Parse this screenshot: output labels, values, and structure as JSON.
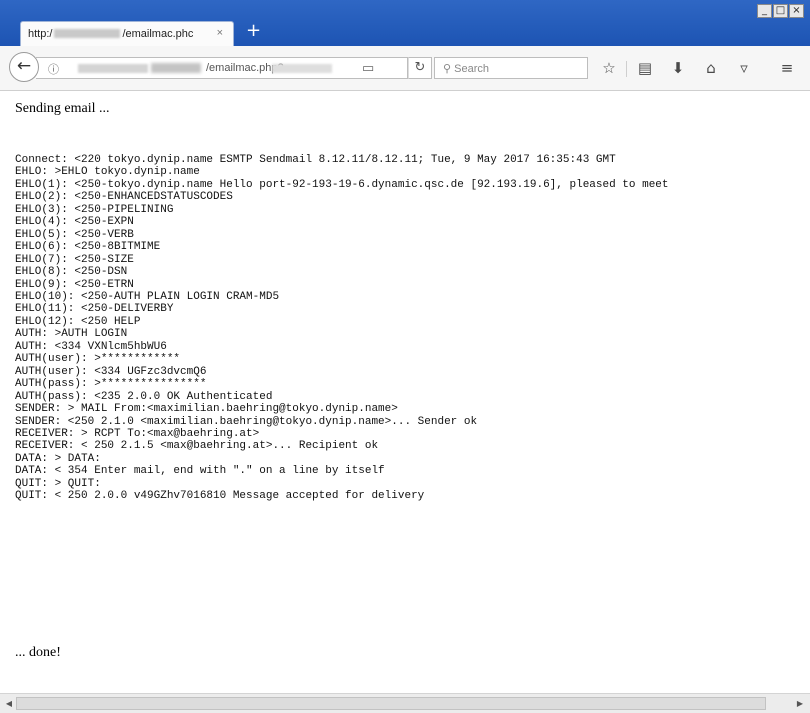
{
  "browser": {
    "tab_title_prefix": "http:/",
    "tab_title_suffix": "/emailmac.phc",
    "tab_close": "×",
    "new_tab": "+",
    "window_buttons": [
      "_",
      "□",
      "×"
    ],
    "url_text": "/emailmac.php?",
    "search_placeholder": "Search",
    "icons": [
      "back-arrow-icon",
      "info-icon",
      "reader-view-icon",
      "reload-icon",
      "search-icon",
      "bookmark-star-icon",
      "bookmarks-library-icon",
      "downloads-icon",
      "home-icon",
      "pocket-icon",
      "menu-icon"
    ]
  },
  "page": {
    "heading": "Sending email ...",
    "log_lines": [
      "Connect: <220 tokyo.dynip.name ESMTP Sendmail 8.12.11/8.12.11; Tue, 9 May 2017 16:35:43 GMT",
      "EHLO: >EHLO tokyo.dynip.name",
      "EHLO(1): <250-tokyo.dynip.name Hello port-92-193-19-6.dynamic.qsc.de [92.193.19.6], pleased to meet",
      "EHLO(2): <250-ENHANCEDSTATUSCODES",
      "EHLO(3): <250-PIPELINING",
      "EHLO(4): <250-EXPN",
      "EHLO(5): <250-VERB",
      "EHLO(6): <250-8BITMIME",
      "EHLO(7): <250-SIZE",
      "EHLO(8): <250-DSN",
      "EHLO(9): <250-ETRN",
      "EHLO(10): <250-AUTH PLAIN LOGIN CRAM-MD5",
      "EHLO(11): <250-DELIVERBY",
      "EHLO(12): <250 HELP",
      "AUTH: >AUTH LOGIN",
      "AUTH: <334 VXNlcm5hbWU6",
      "AUTH(user): >************",
      "AUTH(user): <334 UGFzc3dvcmQ6",
      "AUTH(pass): >****************",
      "AUTH(pass): <235 2.0.0 OK Authenticated",
      "SENDER: > MAIL From:<maximilian.baehring@tokyo.dynip.name>",
      "SENDER: <250 2.1.0 <maximilian.baehring@tokyo.dynip.name>... Sender ok",
      "RECEIVER: > RCPT To:<max@baehring.at>",
      "RECEIVER: < 250 2.1.5 <max@baehring.at>... Recipient ok",
      "DATA: > DATA:",
      "DATA: < 354 Enter mail, end with \".\" on a line by itself",
      "QUIT: > QUIT:",
      "QUIT: < 250 2.0.0 v49GZhv7016810 Message accepted for delivery"
    ],
    "footer": "... done!"
  }
}
